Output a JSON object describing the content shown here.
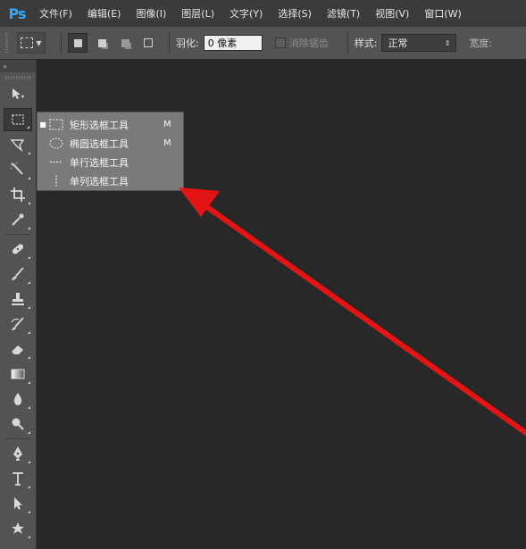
{
  "app": {
    "logo": "Ps"
  },
  "menubar": {
    "items": [
      "文件(F)",
      "编辑(E)",
      "图像(I)",
      "图层(L)",
      "文字(Y)",
      "选择(S)",
      "滤镜(T)",
      "视图(V)",
      "窗口(W)"
    ]
  },
  "options": {
    "feather_label": "羽化:",
    "feather_value": "0 像素",
    "antialias_label": "消除锯齿",
    "style_label": "样式:",
    "style_value": "正常",
    "width_label_cut": "宽度:"
  },
  "toolbox": {
    "collapse_glyph": "»"
  },
  "flyout": {
    "items": [
      {
        "label": "矩形选框工具",
        "shortcut": "M",
        "selected": true,
        "icon": "rect-marquee-icon"
      },
      {
        "label": "椭圆选框工具",
        "shortcut": "M",
        "selected": false,
        "icon": "ellipse-marquee-icon"
      },
      {
        "label": "单行选框工具",
        "shortcut": "",
        "selected": false,
        "icon": "single-row-marquee-icon"
      },
      {
        "label": "单列选框工具",
        "shortcut": "",
        "selected": false,
        "icon": "single-column-marquee-icon"
      }
    ],
    "selected_glyph": "■"
  },
  "colors": {
    "annotation_arrow": "#e31414",
    "ps_blue": "#31a8ff"
  }
}
